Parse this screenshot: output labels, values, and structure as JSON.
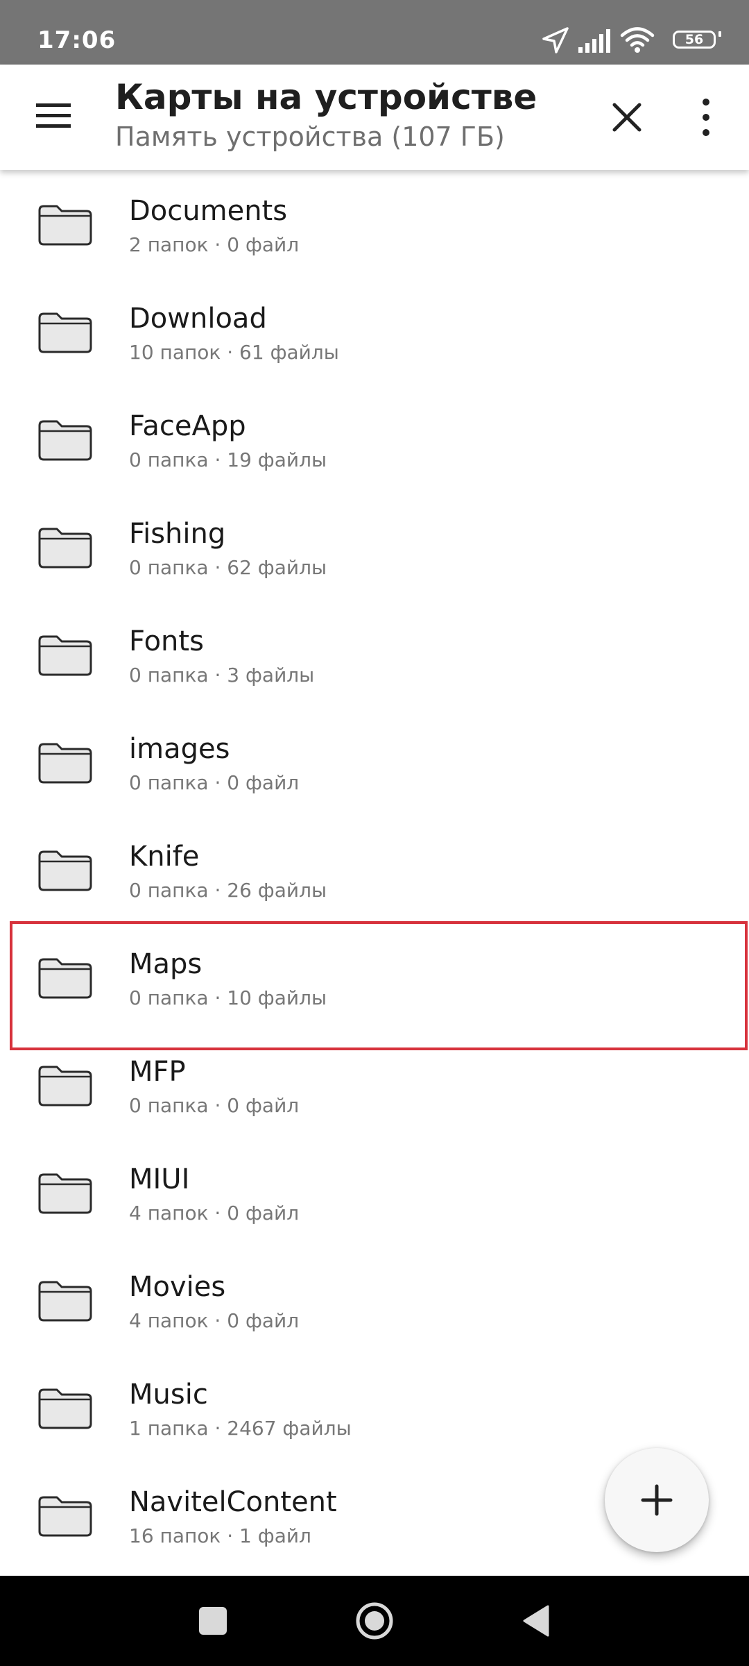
{
  "status_bar": {
    "time": "17:06",
    "battery": "56",
    "icons": [
      "location-arrow-icon",
      "signal-icon",
      "wifi-icon",
      "battery-icon"
    ]
  },
  "toolbar": {
    "title": "Карты на устройстве",
    "subtitle": "Память устройства (107 ГБ)",
    "icons": [
      "menu-icon",
      "close-icon",
      "more-vert-icon"
    ]
  },
  "folders": [
    {
      "name": "Documents",
      "meta": "2 папок · 0 файл"
    },
    {
      "name": "Download",
      "meta": "10 папок · 61 файлы"
    },
    {
      "name": "FaceApp",
      "meta": "0 папка · 19 файлы"
    },
    {
      "name": "Fishing",
      "meta": "0 папка · 62 файлы"
    },
    {
      "name": "Fonts",
      "meta": "0 папка · 3 файлы"
    },
    {
      "name": "images",
      "meta": "0 папка · 0 файл"
    },
    {
      "name": "Knife",
      "meta": "0 папка · 26 файлы"
    },
    {
      "name": "Maps",
      "meta": "0 папка · 10 файлы"
    },
    {
      "name": "MFP",
      "meta": "0 папка · 0 файл"
    },
    {
      "name": "MIUI",
      "meta": "4 папок · 0 файл"
    },
    {
      "name": "Movies",
      "meta": "4 папок · 0 файл"
    },
    {
      "name": "Music",
      "meta": "1 папка · 2467 файлы"
    },
    {
      "name": "NavitelContent",
      "meta": "16 папок · 1 файл"
    }
  ],
  "highlighted_folder": "Maps",
  "colors": {
    "status_bar": "#757575",
    "highlight_border": "#d7323c",
    "folder_fill": "#e8e8e8",
    "folder_stroke": "#2a2a2a"
  },
  "fab": {
    "icon": "plus-icon"
  },
  "nav_bar": {
    "icons": [
      "recents-icon",
      "home-icon",
      "back-icon"
    ]
  }
}
